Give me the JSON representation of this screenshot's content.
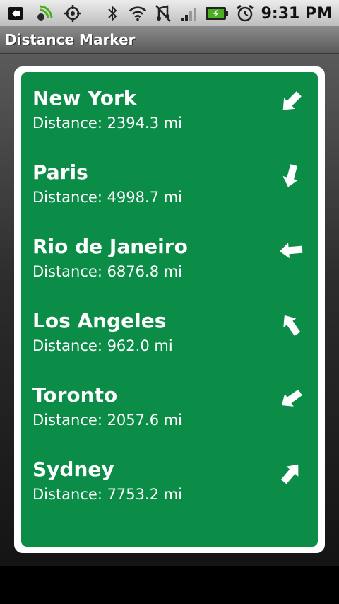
{
  "status_bar": {
    "time": "9:31 PM",
    "icons": [
      "usb-debug-icon",
      "signal-app-icon",
      "gps-icon",
      "bluetooth-icon",
      "wifi-icon",
      "vibrate-off-icon",
      "cell-signal-icon",
      "battery-charging-icon",
      "alarm-icon"
    ]
  },
  "app": {
    "title": "Distance Marker"
  },
  "destinations": [
    {
      "city": "New York",
      "distance": "Distance: 2394.3 mi",
      "arrow_direction": "down-left"
    },
    {
      "city": "Paris",
      "distance": "Distance: 4998.7 mi",
      "arrow_direction": "down"
    },
    {
      "city": "Rio de Janeiro",
      "distance": "Distance: 6876.8 mi",
      "arrow_direction": "left"
    },
    {
      "city": "Los Angeles",
      "distance": "Distance: 962.0 mi",
      "arrow_direction": "up-left"
    },
    {
      "city": "Toronto",
      "distance": "Distance: 2057.6 mi",
      "arrow_direction": "down-left"
    },
    {
      "city": "Sydney",
      "distance": "Distance: 7753.2 mi",
      "arrow_direction": "up-right"
    }
  ],
  "colors": {
    "panel": "#0b8c47",
    "card_border": "#ffffff",
    "text": "#ffffff"
  }
}
